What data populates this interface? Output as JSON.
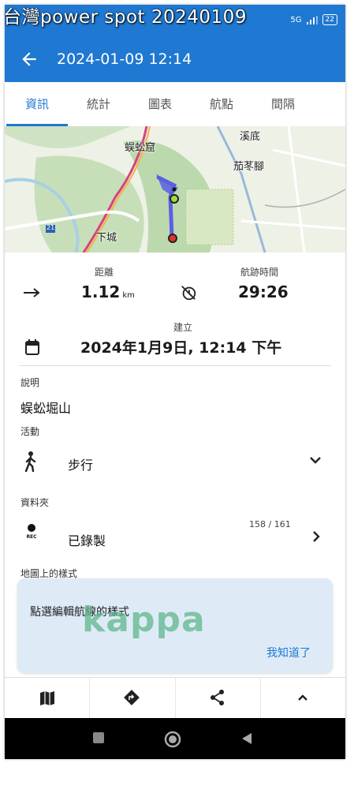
{
  "watermark_title": "台灣power spot 20240109",
  "status_bar": {
    "battery": "22",
    "network": "5G"
  },
  "app_bar": {
    "title": "2024-01-09 12:14"
  },
  "tabs": [
    {
      "label": "資訊",
      "active": true
    },
    {
      "label": "統計",
      "active": false
    },
    {
      "label": "圖表",
      "active": false
    },
    {
      "label": "航點",
      "active": false
    },
    {
      "label": "間隔",
      "active": false
    }
  ],
  "map": {
    "labels": [
      "蜈蚣窟",
      "溪底",
      "茄苳腳",
      "下城",
      "21"
    ]
  },
  "stats": {
    "distance_label": "距離",
    "distance_value": "1.12",
    "distance_unit": "km",
    "duration_label": "航跡時間",
    "duration_value": "29:26",
    "created_label": "建立",
    "created_value": "2024年1月9日, 12:14 下午"
  },
  "description": {
    "label": "說明",
    "value": "蜈蚣堀山"
  },
  "activity": {
    "label": "活動",
    "value": "步行"
  },
  "folder": {
    "label": "資料夾",
    "value": "已錄製",
    "count": "158 / 161",
    "rec_text": "REC"
  },
  "map_style": {
    "label": "地圖上的樣式"
  },
  "tooltip": {
    "text": "點選編輯航線的樣式",
    "action": "我知道了"
  },
  "overlay_text": "kappa",
  "colors": {
    "primary": "#1f78d1",
    "tooltip_bg": "#deebf7",
    "track": "#5b5fe3"
  }
}
